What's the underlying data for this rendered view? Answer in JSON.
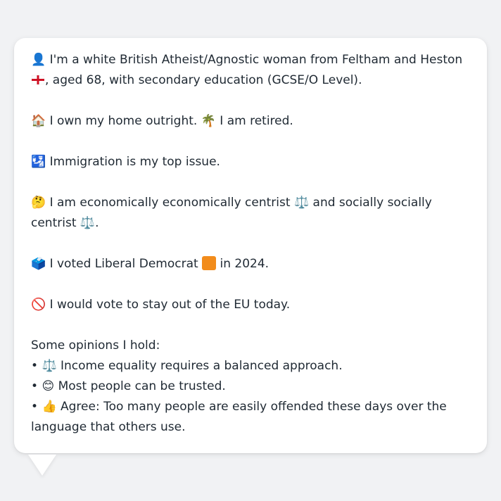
{
  "profile": {
    "intro": {
      "icon": "👤",
      "text_before_flag": " I'm a white British Atheist/Agnostic woman from Feltham and Heston ",
      "flag": "england-flag-icon",
      "text_after_flag": ", aged 68, with secondary education (GCSE/O Level)."
    },
    "housing": {
      "icon": "🏠",
      "text1": " I own my home outright. ",
      "icon2": "🌴",
      "text2": " I am retired."
    },
    "issue": {
      "icon": "🛂",
      "text": " Immigration is my top issue."
    },
    "ideology": {
      "icon": "🤔",
      "text1": " I am economically economically centrist ",
      "icon2": "⚖️",
      "text2": " and socially socially centrist ",
      "icon3": "⚖️",
      "text3": "."
    },
    "vote": {
      "icon": "🗳️",
      "text1": " I voted Liberal Democrat ",
      "party_color": "#f28c1b",
      "text2": " in 2024."
    },
    "eu": {
      "icon": "🚫",
      "text": " I would vote to stay out of the EU today."
    },
    "opinions": {
      "heading": "Some opinions I hold:",
      "items": [
        {
          "bullet": "•",
          "icon": "⚖️",
          "text": " Income equality requires a balanced approach."
        },
        {
          "bullet": "•",
          "icon": "😊",
          "text": " Most people can be trusted."
        },
        {
          "bullet": "•",
          "icon": "👍",
          "text": " Agree: Too many people are easily offended these days over the language that others use."
        }
      ]
    }
  }
}
